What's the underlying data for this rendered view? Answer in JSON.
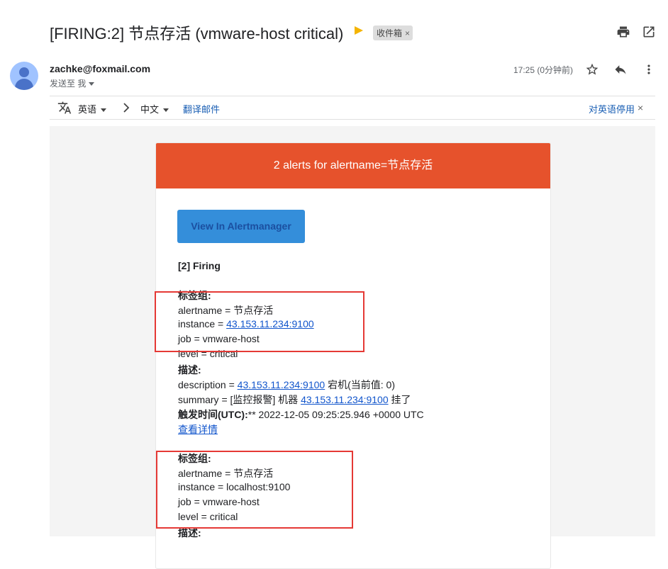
{
  "header": {
    "subject": "[FIRING:2] 节点存活 (vmware-host critical)",
    "label_chip": "收件箱",
    "label_chip_close": "×",
    "icons": [
      "print-icon",
      "open-in-new-window-icon"
    ]
  },
  "message": {
    "sender": "zachke@foxmail.com",
    "to_me": "发送至 我",
    "timestamp": "17:25 (0分钟前)",
    "icons": [
      "star-icon",
      "reply-icon",
      "more-vert-icon"
    ]
  },
  "translate_bar": {
    "source_lang": "英语",
    "target_lang": "中文",
    "translate_link": "翻译邮件",
    "disable_link": "对英语停用",
    "close": "×"
  },
  "email": {
    "header_title": "2 alerts for alertname=节点存活",
    "button_label": "View In Alertmanager",
    "firing_title": "[2] Firing",
    "alert1": {
      "labels_title": "标签组:",
      "alertname_prefix": "alertname = ",
      "alertname_value": "节点存活",
      "instance_prefix": "instance = ",
      "instance_value": "43.153.11.234:9100",
      "job": "job = vmware-host",
      "level": "level = critical",
      "desc_title": "描述:",
      "description_prefix": "description = ",
      "description_link": "43.153.11.234:9100",
      "description_suffix": " 宕机(当前值: 0)",
      "summary_prefix": "summary = [监控报警] 机器 ",
      "summary_link": "43.153.11.234:9100",
      "summary_suffix": " 挂了",
      "trigger_label": "触发时间(UTC):",
      "trigger_value": "** 2022-12-05 09:25:25.946 +0000 UTC",
      "details_link": "查看详情"
    },
    "alert2": {
      "labels_title": "标签组:",
      "alertname": "alertname = 节点存活",
      "instance": "instance = localhost:9100",
      "job": "job = vmware-host",
      "level": "level = critical",
      "desc_title": "描述:"
    }
  },
  "colors": {
    "alert_header": "#e6522c",
    "button": "#348eda",
    "highlight_box": "#e53935",
    "link": "#1155cc"
  }
}
